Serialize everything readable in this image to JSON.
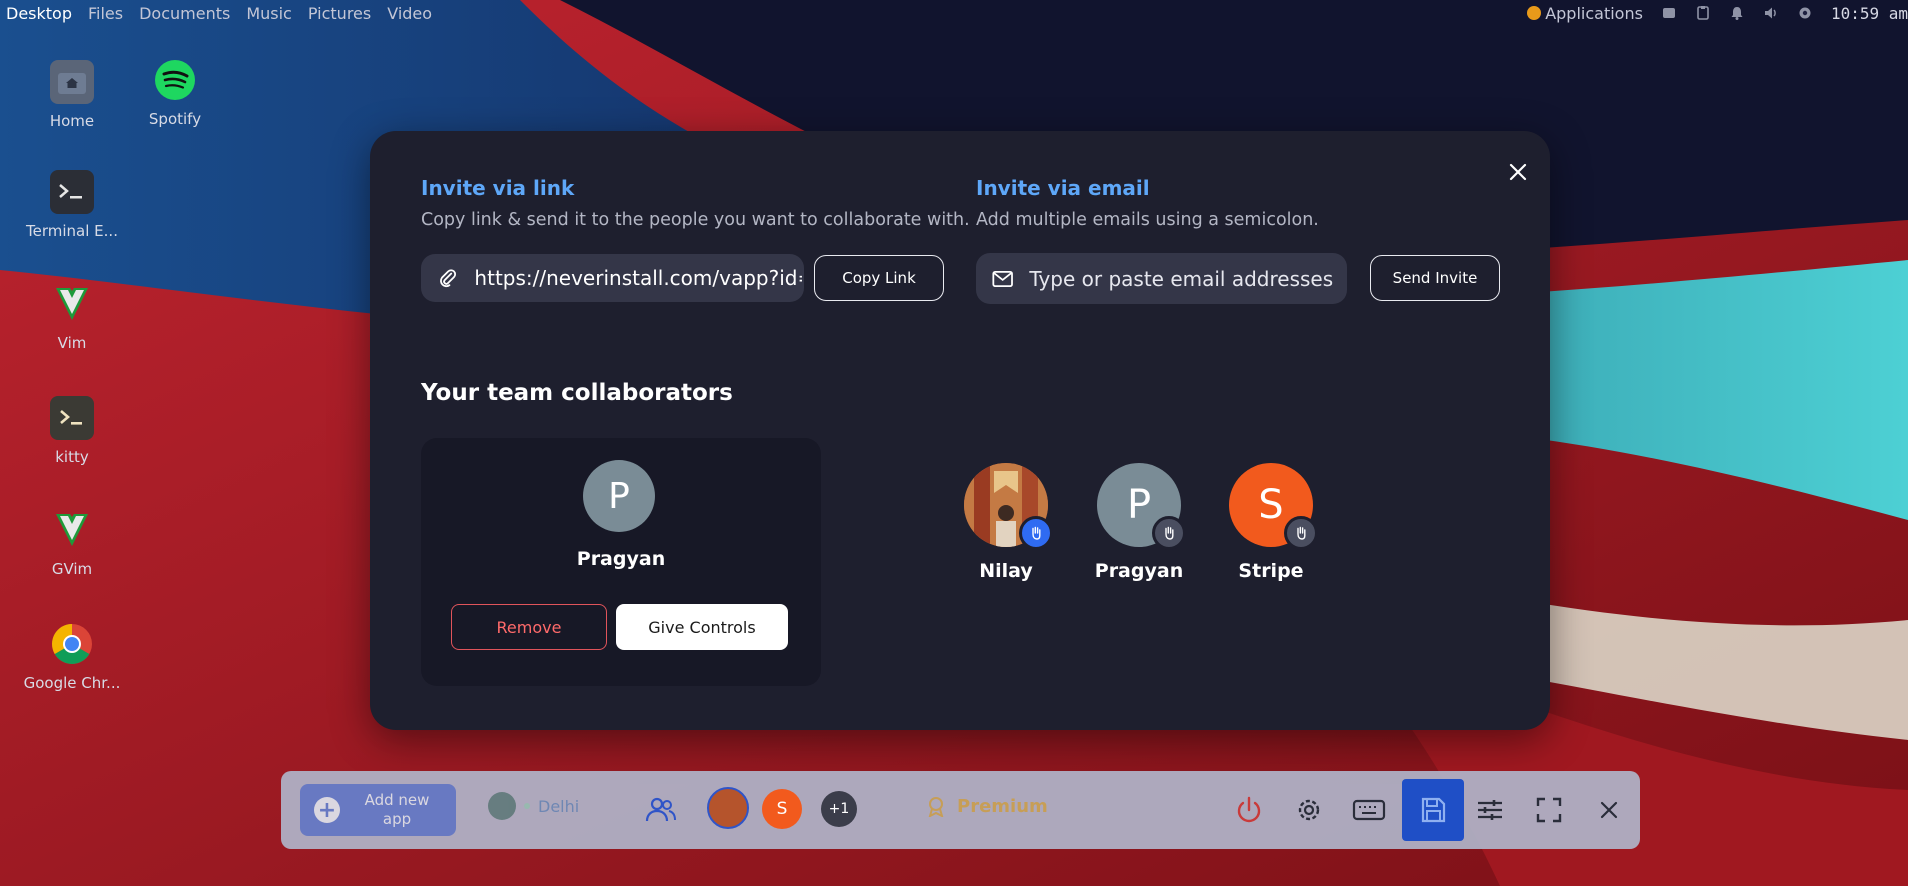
{
  "topbar": {
    "menu": [
      "Desktop",
      "Files",
      "Documents",
      "Music",
      "Pictures",
      "Video"
    ],
    "applications_label": "Applications",
    "clock": "10:59 am"
  },
  "desktop_icons": [
    {
      "label": "Home",
      "icon": "folder-home-icon"
    },
    {
      "label": "Spotify",
      "icon": "spotify-icon"
    },
    {
      "label": "Terminal E...",
      "icon": "terminal-icon"
    },
    {
      "label": "Vim",
      "icon": "vim-icon"
    },
    {
      "label": "kitty",
      "icon": "kitty-icon"
    },
    {
      "label": "GVim",
      "icon": "gvim-icon"
    },
    {
      "label": "Google Chr...",
      "icon": "chrome-icon"
    }
  ],
  "modal": {
    "invite_link": {
      "title": "Invite via link",
      "subtitle": "Copy link & send it to the people you want to collaborate with.",
      "link_value": "https://neverinstall.com/vapp?id=",
      "copy_button": "Copy Link"
    },
    "invite_email": {
      "title": "Invite via email",
      "subtitle": "Add multiple emails using a semicolon.",
      "placeholder": "Type or paste email addresses",
      "send_button": "Send Invite"
    },
    "team": {
      "title": "Your team collaborators",
      "selected": {
        "initial": "P",
        "name": "Pragyan",
        "remove_button": "Remove",
        "give_controls_button": "Give Controls"
      },
      "collaborators": [
        {
          "name": "Nilay",
          "initial": "",
          "color": "#b5542c",
          "has_control": true
        },
        {
          "name": "Pragyan",
          "initial": "P",
          "color": "#7a8c96",
          "has_control": false
        },
        {
          "name": "Stripe",
          "initial": "S",
          "color": "#f25a1d",
          "has_control": false
        }
      ]
    }
  },
  "dock": {
    "add_app_label": "Add new app",
    "region": "Delhi",
    "extra_count": "+1",
    "premium_label": "Premium"
  },
  "colors": {
    "accent_blue": "#5ea7f8",
    "modal_bg": "#1e1f2e",
    "danger": "#ff6a6a",
    "control_badge": "#2f6bf2"
  }
}
